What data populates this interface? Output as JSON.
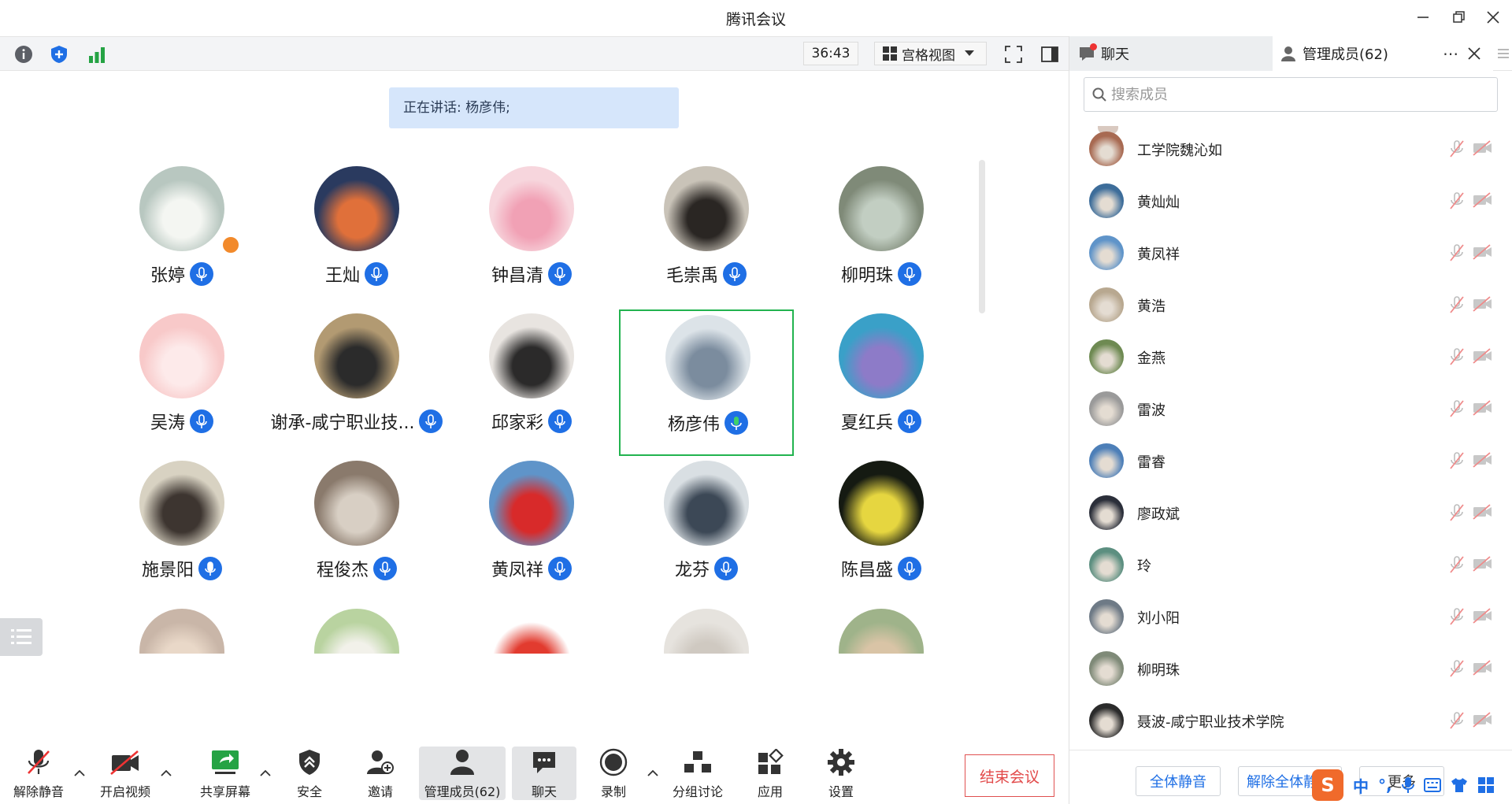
{
  "window": {
    "title": "腾讯会议"
  },
  "topbar": {
    "timer": "36:43",
    "view_label": "宫格视图"
  },
  "speaking": {
    "label": "正在讲话: 杨彦伟;"
  },
  "grid": [
    {
      "name": "张婷",
      "bg": "#b8c7c0",
      "fg": "#f4f6f2",
      "mic": "blue",
      "host": true
    },
    {
      "name": "王灿",
      "bg": "#2a3a5f",
      "fg": "#e0703a",
      "mic": "blue"
    },
    {
      "name": "钟昌清",
      "bg": "#f7d6dd",
      "fg": "#f1a1b5",
      "mic": "blue"
    },
    {
      "name": "毛崇禹",
      "bg": "#c9c3b8",
      "fg": "#2a2623",
      "mic": "blue"
    },
    {
      "name": "柳明珠",
      "bg": "#7f8a78",
      "fg": "#c2cec2",
      "mic": "blue"
    },
    {
      "name": "吴涛",
      "bg": "#f8c9c9",
      "fg": "#fdeaea",
      "mic": "blue"
    },
    {
      "name": "谢承-咸宁职业技...",
      "bg": "#b29a72",
      "fg": "#2b2b2b",
      "mic": "blue"
    },
    {
      "name": "邱家彩",
      "bg": "#e8e4e0",
      "fg": "#2b2a2a",
      "mic": "blue"
    },
    {
      "name": "杨彦伟",
      "bg": "#dce3e8",
      "fg": "#7b8c9e",
      "mic": "speaking",
      "active": true
    },
    {
      "name": "夏红兵",
      "bg": "#3aa0c8",
      "fg": "#8d7bc8",
      "mic": "blue"
    },
    {
      "name": "施景阳",
      "bg": "#d8d2c2",
      "fg": "#3d3530",
      "mic": "solid"
    },
    {
      "name": "程俊杰",
      "bg": "#8a7a6c",
      "fg": "#d8cfc4",
      "mic": "blue"
    },
    {
      "name": "黄凤祥",
      "bg": "#5f94c9",
      "fg": "#d82a2a",
      "mic": "blue"
    },
    {
      "name": "龙芬",
      "bg": "#d9dfe3",
      "fg": "#3c4856",
      "mic": "blue"
    },
    {
      "name": "陈昌盛",
      "bg": "#151a12",
      "fg": "#e6d640",
      "mic": "blue"
    },
    {
      "name": "",
      "bg": "#c9b6a8",
      "fg": "#e9d8c8"
    },
    {
      "name": "",
      "bg": "#b9d3a0",
      "fg": "#f2f1ea"
    },
    {
      "name": "",
      "bg": "#ffffff",
      "fg": "#e23b2f"
    },
    {
      "name": "",
      "bg": "#e6e3de",
      "fg": "#cfc9c1"
    },
    {
      "name": "",
      "bg": "#9fb38a",
      "fg": "#d9c4a6"
    }
  ],
  "bottombar": {
    "unmute": "解除静音",
    "video": "开启视频",
    "share": "共享屏幕",
    "security": "安全",
    "invite": "邀请",
    "members": "管理成员(62)",
    "chat": "聊天",
    "record": "录制",
    "breakout": "分组讨论",
    "apps": "应用",
    "settings": "设置",
    "end": "结束会议"
  },
  "panel": {
    "tab_chat": "聊天",
    "tab_members": "管理成员(62)",
    "search_placeholder": "搜索成员",
    "members": [
      {
        "name": "工学院魏沁如",
        "color": "#a86a52"
      },
      {
        "name": "黄灿灿",
        "color": "#3d6d9a"
      },
      {
        "name": "黄凤祥",
        "color": "#5f94c9"
      },
      {
        "name": "黄浩",
        "color": "#b8a890"
      },
      {
        "name": "金燕",
        "color": "#6e8a52"
      },
      {
        "name": "雷波",
        "color": "#9a9a9a"
      },
      {
        "name": "雷睿",
        "color": "#4d7fb8"
      },
      {
        "name": "廖政斌",
        "color": "#2b2f3a"
      },
      {
        "name": "玲",
        "color": "#5c8f80"
      },
      {
        "name": "刘小阳",
        "color": "#6e7a86"
      },
      {
        "name": "柳明珠",
        "color": "#7f8a78"
      },
      {
        "name": "聂波-咸宁职业技术学院",
        "color": "#2b2b2b"
      }
    ],
    "mute_all": "全体静音",
    "unmute_all": "解除全体静音",
    "more": "更多"
  },
  "ime": {
    "lang": "中",
    "punct": "°,"
  },
  "colors": {
    "accent": "#1f6fe5",
    "danger": "#e24a4a",
    "speaking_border": "#22b34f"
  }
}
